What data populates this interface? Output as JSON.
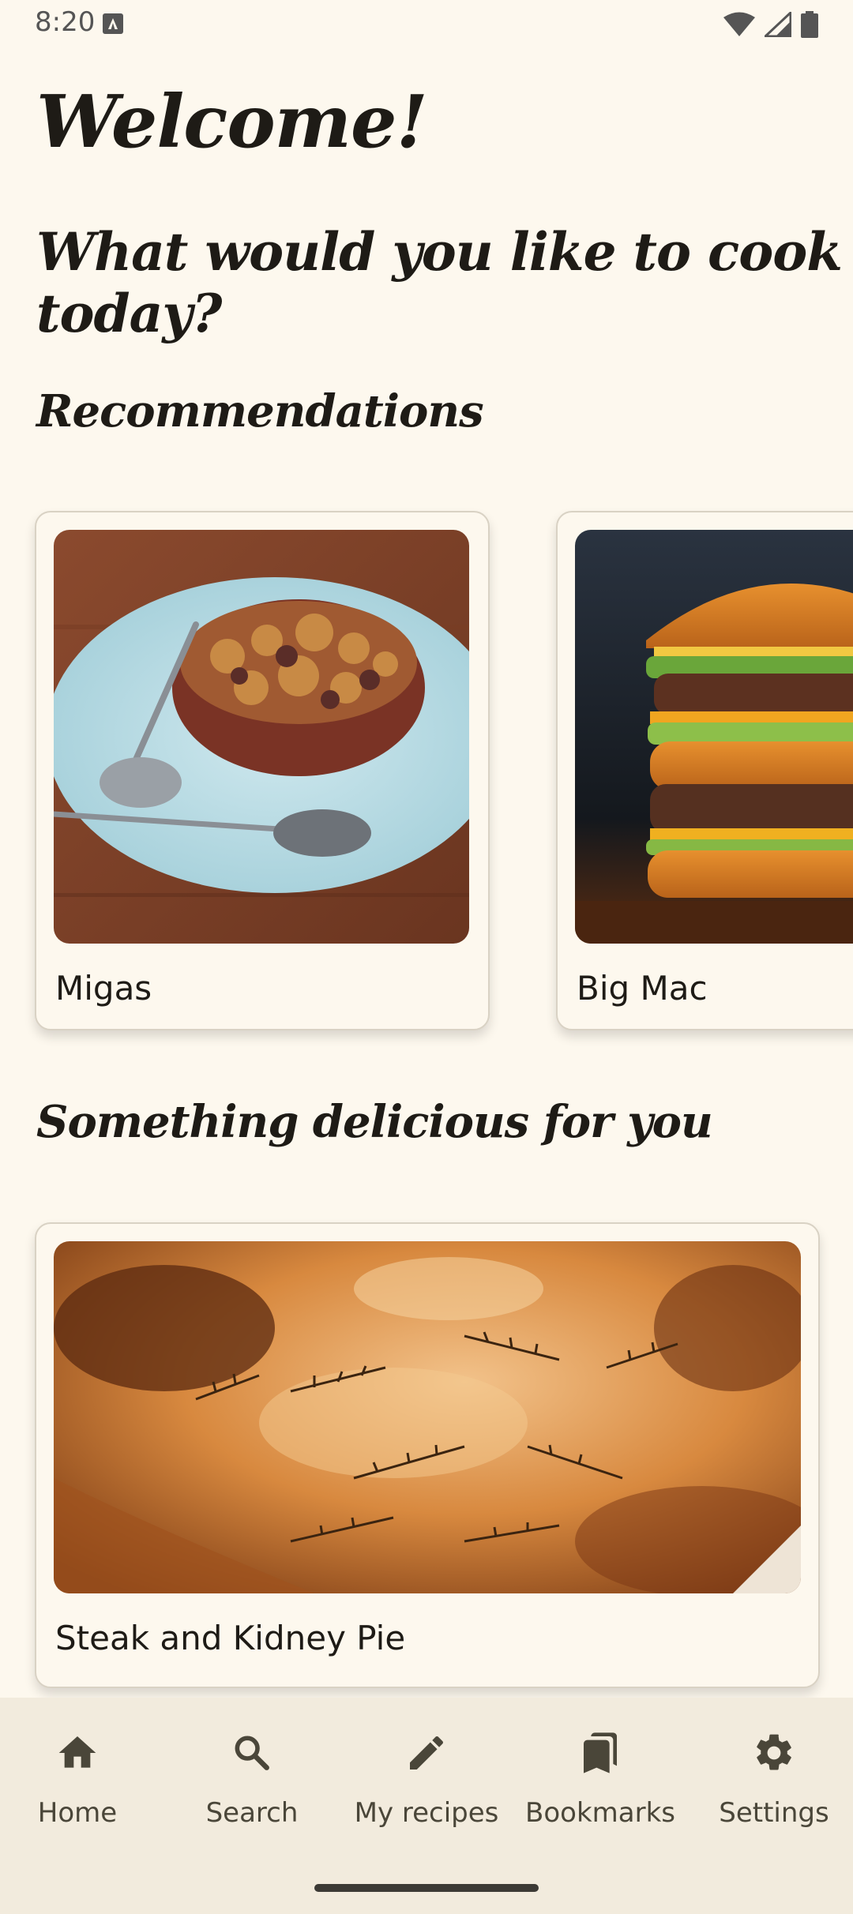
{
  "status_bar": {
    "time": "8:20"
  },
  "header": {
    "welcome": "Welcome!",
    "subtitle": "What would you like to cook today?"
  },
  "recommendations": {
    "title": "Recommendations",
    "items": [
      {
        "name": "Migas",
        "image": "migas-photo"
      },
      {
        "name": "Big Mac",
        "image": "burger-photo"
      }
    ]
  },
  "delicious": {
    "title": "Something delicious for you",
    "items": [
      {
        "name": "Steak and Kidney Pie",
        "image": "pie-photo"
      }
    ]
  },
  "bottom_nav": {
    "items": [
      {
        "label": "Home",
        "icon": "home-icon"
      },
      {
        "label": "Search",
        "icon": "search-icon"
      },
      {
        "label": "My recipes",
        "icon": "pencil-icon"
      },
      {
        "label": "Bookmarks",
        "icon": "bookmarks-icon"
      },
      {
        "label": "Settings",
        "icon": "gear-icon"
      }
    ]
  },
  "colors": {
    "background": "#fdf8ee",
    "nav_background": "#f2ebdd",
    "text": "#1e1b16"
  }
}
